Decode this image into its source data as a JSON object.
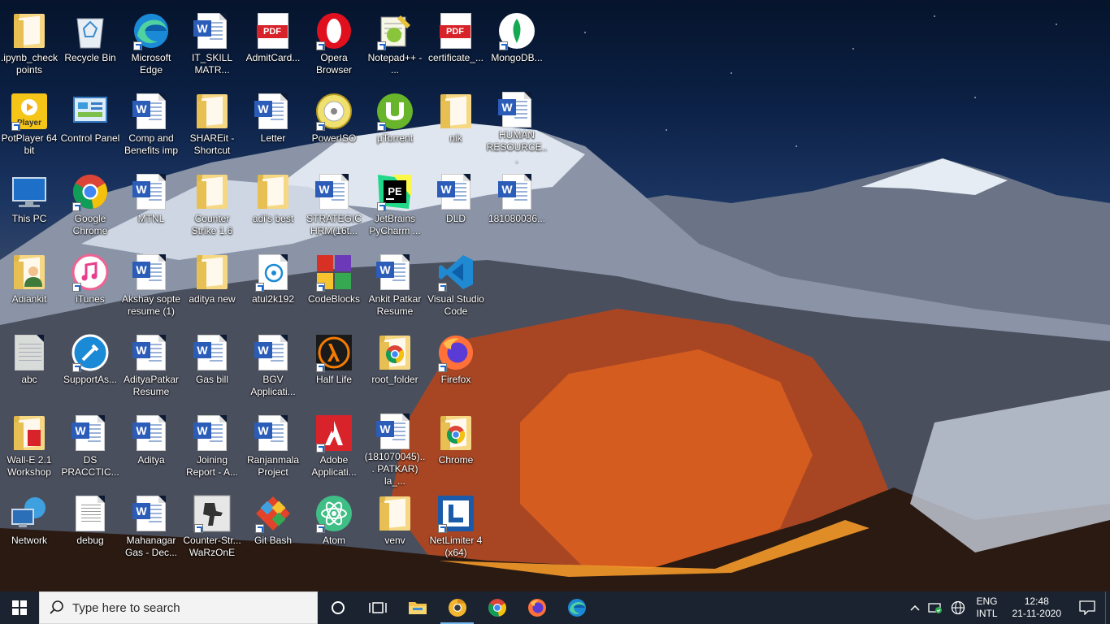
{
  "desktop": {
    "icons": [
      {
        "label": ".ipynb_check points",
        "icon": "folder-icon"
      },
      {
        "label": "Recycle Bin",
        "icon": "recycle-bin-icon"
      },
      {
        "label": "Microsoft Edge",
        "icon": "edge-icon"
      },
      {
        "label": "IT_SKILL MATR...",
        "icon": "word-document-icon"
      },
      {
        "label": "AdmitCard...",
        "icon": "pdf-icon"
      },
      {
        "label": "Opera Browser",
        "icon": "opera-icon"
      },
      {
        "label": "Notepad++ - ...",
        "icon": "notepad-plus-plus-icon"
      },
      {
        "label": "certificate_...",
        "icon": "pdf-icon"
      },
      {
        "label": "MongoDB...",
        "icon": "mongodb-icon"
      },
      {
        "label": "PotPlayer 64 bit",
        "icon": "potplayer-icon"
      },
      {
        "label": "Control Panel",
        "icon": "control-panel-icon"
      },
      {
        "label": "Comp and Benefits imp",
        "icon": "word-document-icon"
      },
      {
        "label": "SHAREit - Shortcut",
        "icon": "folder-icon"
      },
      {
        "label": "Letter",
        "icon": "word-document-icon"
      },
      {
        "label": "PowerISO",
        "icon": "poweriso-icon"
      },
      {
        "label": "µTorrent",
        "icon": "utorrent-icon"
      },
      {
        "label": "nik",
        "icon": "folder-icon"
      },
      {
        "label": "HUMAN RESOURCE...",
        "icon": "word-document-icon"
      },
      {
        "label": "This PC",
        "icon": "this-pc-icon"
      },
      {
        "label": "Google Chrome",
        "icon": "chrome-icon"
      },
      {
        "label": "MTNL",
        "icon": "word-document-icon"
      },
      {
        "label": "Counter Strike 1.6",
        "icon": "folder-icon"
      },
      {
        "label": "adi's best",
        "icon": "folder-icon"
      },
      {
        "label": "STRATEGIC HRM(16t...",
        "icon": "word-document-icon"
      },
      {
        "label": "JetBrains PyCharm ...",
        "icon": "pycharm-icon"
      },
      {
        "label": "DLD",
        "icon": "word-document-icon"
      },
      {
        "label": "181080036...",
        "icon": "word-document-icon"
      },
      {
        "label": "Adiankit",
        "icon": "user-folder-icon"
      },
      {
        "label": "iTunes",
        "icon": "itunes-icon"
      },
      {
        "label": "Akshay sopte resume (1)",
        "icon": "word-document-icon"
      },
      {
        "label": "aditya new",
        "icon": "folder-icon"
      },
      {
        "label": "atul2k192",
        "icon": "media-file-icon"
      },
      {
        "label": "CodeBlocks",
        "icon": "codeblocks-icon"
      },
      {
        "label": "Ankit Patkar Resume",
        "icon": "word-document-icon"
      },
      {
        "label": "Visual Studio Code",
        "icon": "vscode-icon"
      },
      {
        "label": "abc",
        "icon": "image-file-icon"
      },
      {
        "label": "SupportAs...",
        "icon": "support-assist-icon"
      },
      {
        "label": "AdityaPatkar Resume",
        "icon": "word-document-icon"
      },
      {
        "label": "Gas bill",
        "icon": "word-document-icon"
      },
      {
        "label": "BGV Applicati...",
        "icon": "word-document-icon"
      },
      {
        "label": "Half Life",
        "icon": "half-life-icon"
      },
      {
        "label": "root_folder",
        "icon": "chrome-folder-icon"
      },
      {
        "label": "Firefox",
        "icon": "firefox-icon"
      },
      {
        "label": "Wall-E 2.1 Workshop",
        "icon": "pdf-folder-icon"
      },
      {
        "label": "DS PRACCTIC...",
        "icon": "word-document-icon"
      },
      {
        "label": "Aditya",
        "icon": "word-document-icon"
      },
      {
        "label": "Joining Report - A...",
        "icon": "word-document-icon"
      },
      {
        "label": "Ranjanmala Project",
        "icon": "word-document-icon"
      },
      {
        "label": "Adobe Applicati...",
        "icon": "adobe-icon"
      },
      {
        "label": "(181070045)... PATKAR) la_...",
        "icon": "word-document-icon"
      },
      {
        "label": "Chrome",
        "icon": "chrome-folder-icon"
      },
      {
        "label": "Network",
        "icon": "network-icon"
      },
      {
        "label": "debug",
        "icon": "text-file-icon"
      },
      {
        "label": "Mahanagar Gas - Dec...",
        "icon": "word-document-icon"
      },
      {
        "label": "Counter-Str... WaRzOnE",
        "icon": "counter-strike-icon"
      },
      {
        "label": "Git Bash",
        "icon": "git-bash-icon"
      },
      {
        "label": "Atom",
        "icon": "atom-icon"
      },
      {
        "label": "venv",
        "icon": "folder-icon"
      },
      {
        "label": "NetLimiter 4 (x64)",
        "icon": "netlimiter-icon"
      }
    ]
  },
  "taskbar": {
    "search_placeholder": "Type here to search",
    "pinned": [
      "cortana-icon",
      "task-view-icon",
      "file-explorer-icon",
      "chrome-canary-icon",
      "chrome-icon",
      "firefox-icon",
      "edge-icon"
    ],
    "tray": {
      "lang_line1": "ENG",
      "lang_line2": "INTL",
      "time": "12:48",
      "date": "21-11-2020"
    }
  },
  "colors": {
    "taskbar_bg": "#1b2330",
    "word_blue": "#2b5cb8",
    "pdf_red": "#d8232a",
    "active_indicator": "#76b9ed"
  }
}
